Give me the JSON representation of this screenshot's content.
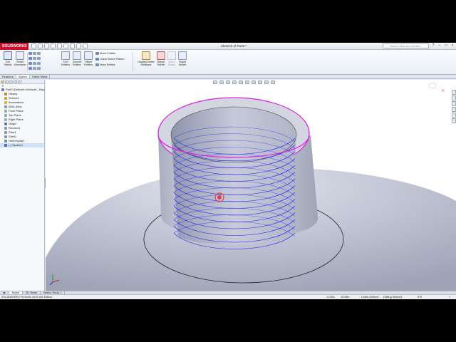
{
  "app": {
    "brand": "SOLIDWORKS",
    "document_title": "Sketch3 of Part2 *",
    "search_placeholder": "Search files and models"
  },
  "ribbon": {
    "big_buttons": [
      {
        "label1": "Exit",
        "label2": "Sketch"
      },
      {
        "label1": "Smart",
        "label2": "Dimension"
      },
      {
        "label1": "Trim",
        "label2": "Entities"
      },
      {
        "label1": "Convert",
        "label2": "Entities"
      },
      {
        "label1": "Offset",
        "label2": "Entities"
      },
      {
        "label1": "Display/Delete",
        "label2": "Relations"
      },
      {
        "label1": "Repair",
        "label2": "Sketch"
      },
      {
        "label1": "Quick",
        "label2": "Snaps"
      },
      {
        "label1": "Rapid",
        "label2": "Sketch"
      }
    ],
    "small_buttons": [
      "Mirror Entities",
      "Linear Sketch Pattern",
      "Move Entities"
    ]
  },
  "command_tabs": [
    "Features",
    "Sketch",
    "Sheet Metal"
  ],
  "feature_tree": {
    "items": [
      {
        "label": "Part2  (Default<<Default>_Disp",
        "indent": 0,
        "color": "#6b7fa8"
      },
      {
        "label": "History",
        "indent": 1,
        "color": "#b7884a"
      },
      {
        "label": "Sensors",
        "indent": 1,
        "color": "#d2a23a"
      },
      {
        "label": "Annotations",
        "indent": 1,
        "color": "#d9b24a"
      },
      {
        "label": "6061 Alloy",
        "indent": 1,
        "color": "#8a9bb3"
      },
      {
        "label": "Front Plane",
        "indent": 1,
        "color": "#9aa6b8"
      },
      {
        "label": "Top Plane",
        "indent": 1,
        "color": "#9aa6b8"
      },
      {
        "label": "Right Plane",
        "indent": 1,
        "color": "#9aa6b8"
      },
      {
        "label": "Origin",
        "indent": 1,
        "color": "#5f7aa0"
      },
      {
        "label": "Revolve1",
        "indent": 1,
        "color": "#8a96aa"
      },
      {
        "label": "Fillet1",
        "indent": 1,
        "color": "#8a96aa"
      },
      {
        "label": "Shell1",
        "indent": 1,
        "color": "#8a96aa"
      },
      {
        "label": "Helix/Spiral1",
        "indent": 1,
        "color": "#7a8aa8"
      },
      {
        "label": "(-) Sketch3",
        "indent": 1,
        "color": "#4a6fb5"
      }
    ]
  },
  "bottom_tabs": [
    "Model",
    "3D Views",
    "Motion Study 1"
  ],
  "status_bar": {
    "edition": "SOLIDWORKS Premium 2015 x64 Edition",
    "x": "-0.26in",
    "y": "15.98in",
    "state": "Under Defined",
    "mode": "Editing Sketch3",
    "units": "IPS"
  },
  "colors": {
    "sketch_edge": "#e020e0",
    "helix": "#1a1aff",
    "body": "#b9bdcc",
    "cursor": "#e0404a"
  },
  "icons": [
    "search-icon",
    "close-icon",
    "triad-icon",
    "cursor-icon"
  ]
}
